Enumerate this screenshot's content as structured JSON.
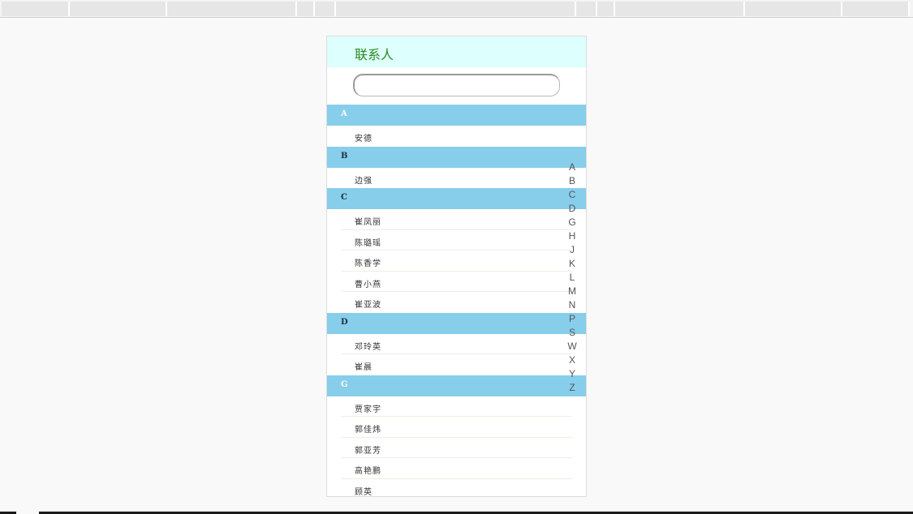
{
  "browser": {
    "tabs": [
      {
        "width": 84
      },
      {
        "width": 120
      },
      {
        "width": 160
      },
      {
        "width": 22
      },
      {
        "width": 26
      },
      {
        "width": 296
      },
      {
        "width": 26
      },
      {
        "width": 22
      },
      {
        "width": 160
      },
      {
        "width": 120
      },
      {
        "width": 83
      }
    ]
  },
  "app": {
    "title": "联系人",
    "search": {
      "value": "",
      "placeholder": ""
    },
    "groups": [
      {
        "letter": "A",
        "letter_dark": false,
        "contacts": [
          "安德"
        ]
      },
      {
        "letter": "B",
        "letter_dark": true,
        "contacts": [
          "边强"
        ]
      },
      {
        "letter": "C",
        "letter_dark": true,
        "contacts": [
          "崔凤丽",
          "陈璐瑶",
          "陈香学",
          "曹小燕",
          "崔亚波"
        ]
      },
      {
        "letter": "D",
        "letter_dark": true,
        "contacts": [
          "邓玲英",
          "崔晨"
        ]
      },
      {
        "letter": "G",
        "letter_dark": false,
        "contacts": [
          "贾家宇",
          "郭佳炜",
          "郭亚芳",
          "高艳鹏",
          "顾英"
        ]
      }
    ],
    "index": [
      "A",
      "B",
      "C",
      "D",
      "G",
      "H",
      "J",
      "K",
      "L",
      "M",
      "N",
      "P",
      "S",
      "W",
      "X",
      "Y",
      "Z"
    ]
  }
}
